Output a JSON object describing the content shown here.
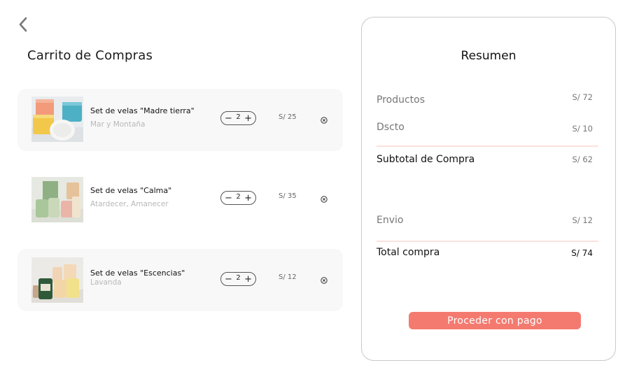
{
  "page": {
    "title": "Carrito de Compras"
  },
  "cart": {
    "items": [
      {
        "name": "Set de velas \"Madre tierra\"",
        "variant": "Mar y Montaña",
        "quantity": "2",
        "price": "S/ 25"
      },
      {
        "name": "Set de velas \"Calma\"",
        "variant": "Atardecer, Amanecer",
        "quantity": "2",
        "price": "S/ 35"
      },
      {
        "name": "Set de velas \"Escencias\"",
        "variant": "Lavanda",
        "quantity": "2",
        "price": "S/ 12"
      }
    ],
    "minus_symbol": "−",
    "plus_symbol": "+"
  },
  "summary": {
    "title": "Resumen",
    "products_label": "Productos",
    "products_value": "S/ 72",
    "discount_label": "Dscto",
    "discount_value": "S/ 10",
    "subtotal_label": "Subtotal de Compra",
    "subtotal_value": "S/ 62",
    "shipping_label": "Envio",
    "shipping_value": "S/ 12",
    "total_label": "Total compra",
    "total_value": "S/ 74",
    "pay_button": "Proceder con pago"
  },
  "colors": {
    "accent": "#f47a70",
    "divider": "#fbe2dc",
    "row_shade": "#f8f8f8"
  },
  "icons": {
    "back": "chevron-left-icon",
    "remove": "close-circle-icon"
  }
}
